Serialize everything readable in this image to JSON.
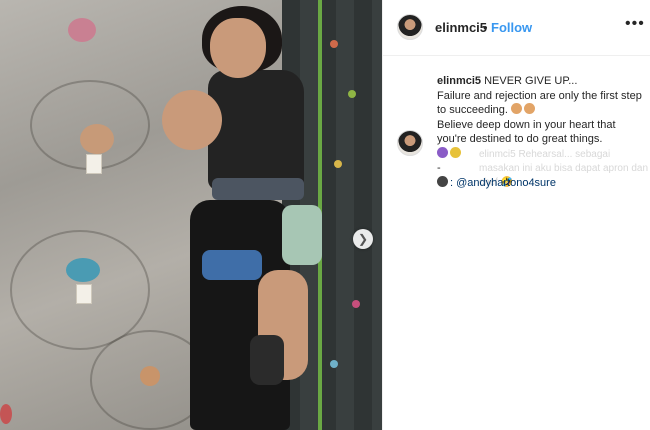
{
  "post": {
    "username": "elinmci5",
    "separator": "•",
    "follow_label": "Follow",
    "more_label": "•••"
  },
  "caption": {
    "username": "elinmci5",
    "line1": "NEVER GIVE UP...",
    "line2": "Failure and rejection are only the first step to succeeding.",
    "line3": "Believe deep down in your heart that you're destined to do great things.",
    "line4": "-",
    "mention": ": @andyhartono4sure"
  },
  "ghost_comment": {
    "text": "elinmci5 Rehearsal... sebagai masakan ini aku bisa dapat apron dan chef 🤣"
  },
  "icons": {
    "next": "chevron-right-icon",
    "more": "more-options-icon"
  },
  "colors": {
    "follow": "#3897f0",
    "text": "#262626",
    "mention": "#003569"
  }
}
